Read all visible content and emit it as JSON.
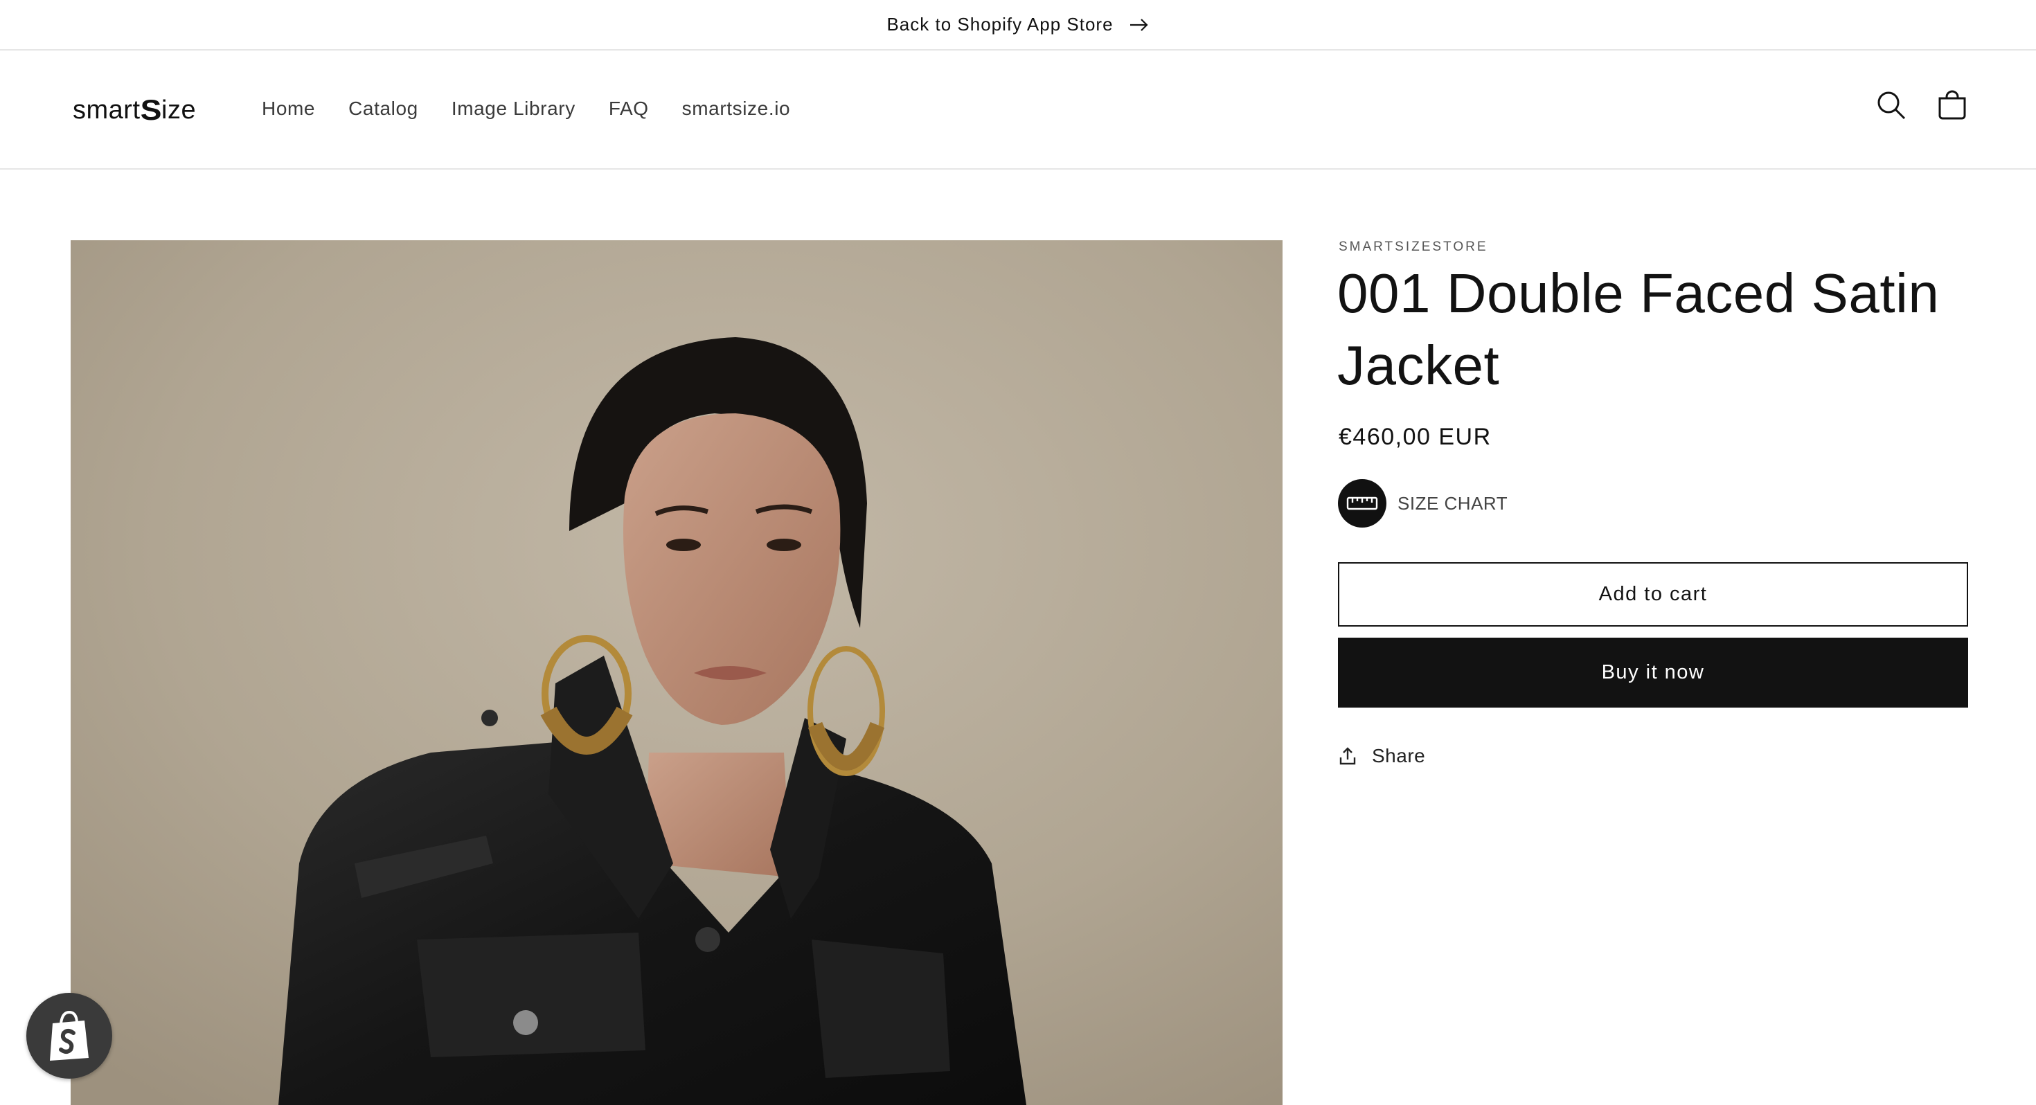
{
  "announcement": {
    "text": "Back to Shopify App Store",
    "icon": "arrow-right-icon"
  },
  "header": {
    "logo": {
      "prefix": "smart",
      "mark": "S",
      "suffix": "ize"
    },
    "nav": [
      {
        "label": "Home"
      },
      {
        "label": "Catalog"
      },
      {
        "label": "Image Library"
      },
      {
        "label": "FAQ"
      },
      {
        "label": "smartsize.io"
      }
    ],
    "icons": {
      "search": "search-icon",
      "cart": "cart-icon"
    }
  },
  "product": {
    "vendor": "SMARTSIZESTORE",
    "title": "001 Double Faced Satin Jacket",
    "price": "€460,00 EUR",
    "size_chart_label": "SIZE CHART",
    "size_chart_icon": "ruler-icon",
    "add_to_cart": "Add to cart",
    "buy_now": "Buy it now",
    "share": "Share",
    "share_icon": "share-icon"
  },
  "shopify_badge": {
    "icon": "shopify-bag-icon"
  },
  "colors": {
    "text": "#121212",
    "button_dark": "#121212",
    "border": "#e6e6e6",
    "photo_background": "#b1a694"
  }
}
